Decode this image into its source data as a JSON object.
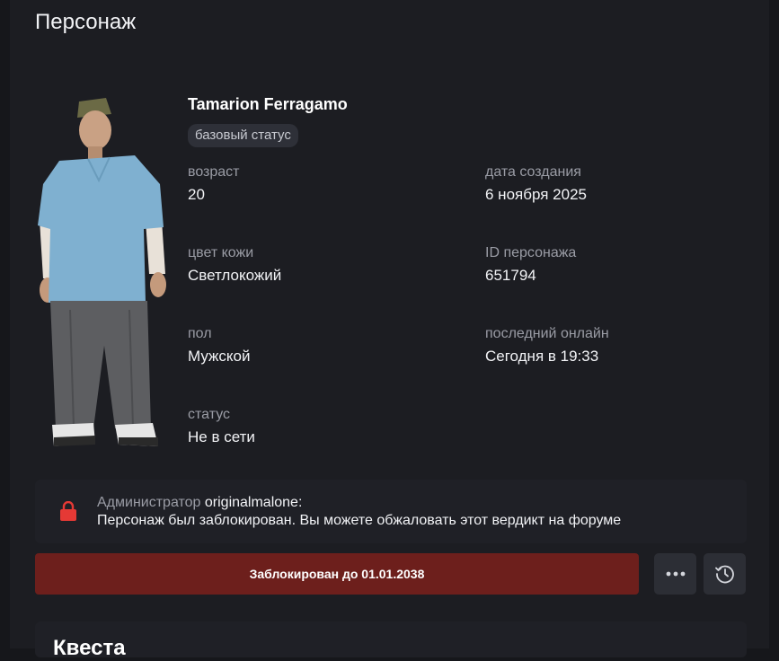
{
  "page": {
    "title": "Персонаж"
  },
  "character": {
    "name": "Tamarion Ferragamo",
    "badge": "базовый статус",
    "fields": {
      "age": {
        "label": "возраст",
        "value": "20"
      },
      "created": {
        "label": "дата создания",
        "value": "6 ноября 2025"
      },
      "skin": {
        "label": "цвет кожи",
        "value": "Светлокожий"
      },
      "id": {
        "label": "ID персонажа",
        "value": "651794"
      },
      "gender": {
        "label": "пол",
        "value": "Мужской"
      },
      "last_online": {
        "label": "последний онлайн",
        "value": "Сегодня в 19:33"
      },
      "status": {
        "label": "статус",
        "value": "Не в сети"
      }
    }
  },
  "ban_notice": {
    "admin_prefix": "Администратор",
    "admin_name": "originalmalone:",
    "message": "Персонаж был заблокирован. Вы можете обжаловать этот вердикт на форуме",
    "icon": "lock-icon",
    "icon_color": "#e53935"
  },
  "actions": {
    "blocked_label": "Заблокирован до 01.01.2038",
    "blocked_color": "#6d1f1c",
    "more_icon": "more-dots-icon",
    "history_icon": "history-clock-icon"
  },
  "next_section": {
    "title": "Квеста"
  }
}
